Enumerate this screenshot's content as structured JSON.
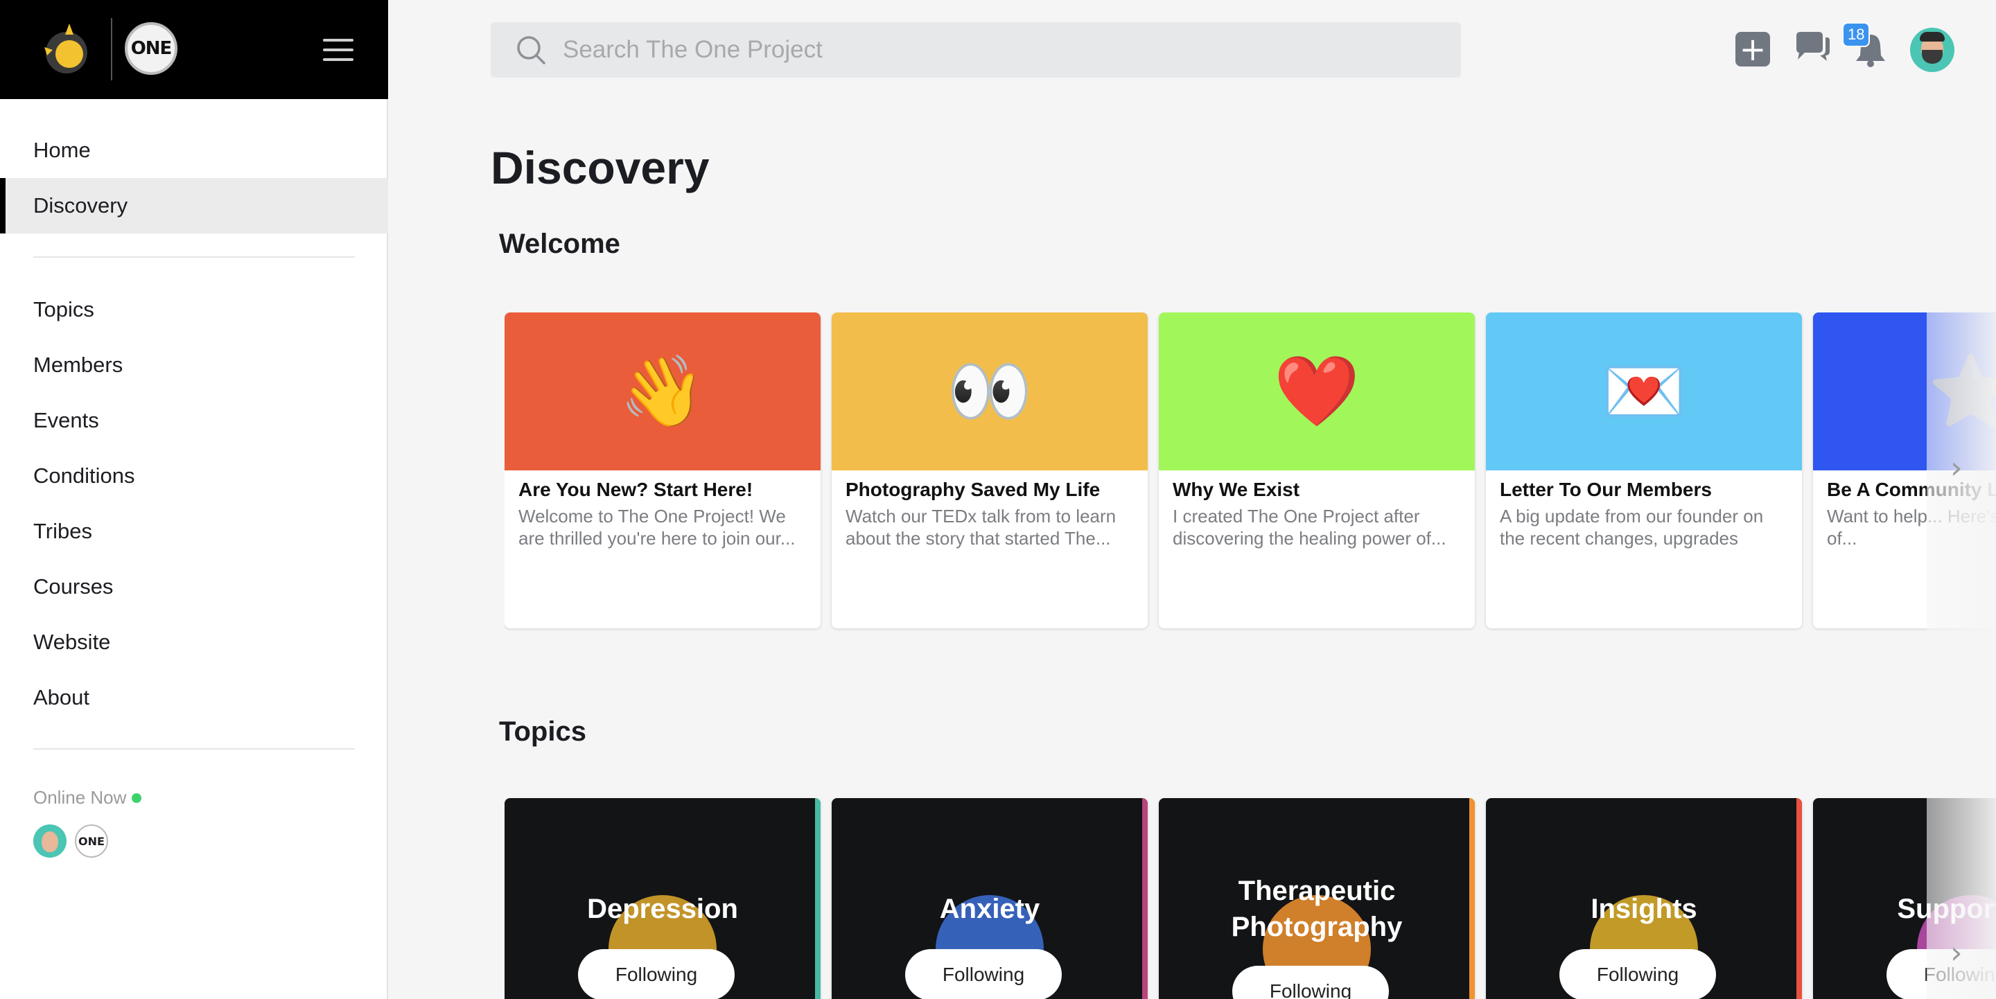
{
  "brand": {
    "logo_text": "ONE",
    "menu_icon": "hamburger-icon"
  },
  "sidebar": {
    "primary": [
      {
        "label": "Home"
      },
      {
        "label": "Discovery",
        "active": true
      }
    ],
    "secondary": [
      {
        "label": "Topics"
      },
      {
        "label": "Members"
      },
      {
        "label": "Events"
      },
      {
        "label": "Conditions"
      },
      {
        "label": "Tribes"
      },
      {
        "label": "Courses"
      },
      {
        "label": "Website"
      },
      {
        "label": "About"
      }
    ],
    "online_label": "Online Now",
    "online_avatar_logo_text": "ONE"
  },
  "search": {
    "placeholder": "Search The One Project",
    "value": ""
  },
  "header": {
    "notification_count": "18",
    "icons": [
      "plus-icon",
      "chat-icon",
      "bell-icon",
      "avatar"
    ]
  },
  "main": {
    "page_title": "Discovery",
    "welcome": {
      "title": "Welcome",
      "cards": [
        {
          "emoji": "👋",
          "color": "#ea5d3b",
          "title": "Are You New? Start Here!",
          "desc": "Welcome to The One Project! We are thrilled you're here to join our..."
        },
        {
          "emoji": "👀",
          "color": "#f2bd4b",
          "title": "Photography Saved My Life",
          "desc": "Watch our TEDx talk from to learn about the story that started The..."
        },
        {
          "emoji": "❤️",
          "color": "#a1f75a",
          "title": "Why We Exist",
          "desc": "I created The One Project after discovering the healing power of..."
        },
        {
          "emoji": "💌",
          "color": "#62c8f6",
          "title": "Letter To Our Members",
          "desc": "A big update from our founder on the recent changes, upgrades and..."
        },
        {
          "emoji": "⭐",
          "color": "#2f56f0",
          "title": "Be A Community L",
          "desc": "Want to help... Here's a quick list of..."
        }
      ]
    },
    "topics": {
      "title": "Topics",
      "cards": [
        {
          "name": "Depression",
          "button": "Following",
          "accent": "#47b9a6",
          "emoji_color": "#e2a92c"
        },
        {
          "name": "Anxiety",
          "button": "Following",
          "accent": "#b7457a",
          "emoji_color": "#3d6fd6"
        },
        {
          "name": "Therapeutic Photography",
          "button": "Following",
          "accent": "#f2922e",
          "emoji_color": "#f2922e"
        },
        {
          "name": "Insights",
          "button": "Following",
          "accent": "#e8503f",
          "emoji_color": "#e2b12c"
        },
        {
          "name": "Supporting",
          "button": "Following",
          "accent": "#9b4fd0",
          "emoji_color": "#c44fb6"
        }
      ]
    }
  },
  "colors": {
    "brand_black": "#000000",
    "active_bg": "#ebebeb",
    "online_green": "#3dd26d",
    "badge_blue": "#3b93f0"
  }
}
